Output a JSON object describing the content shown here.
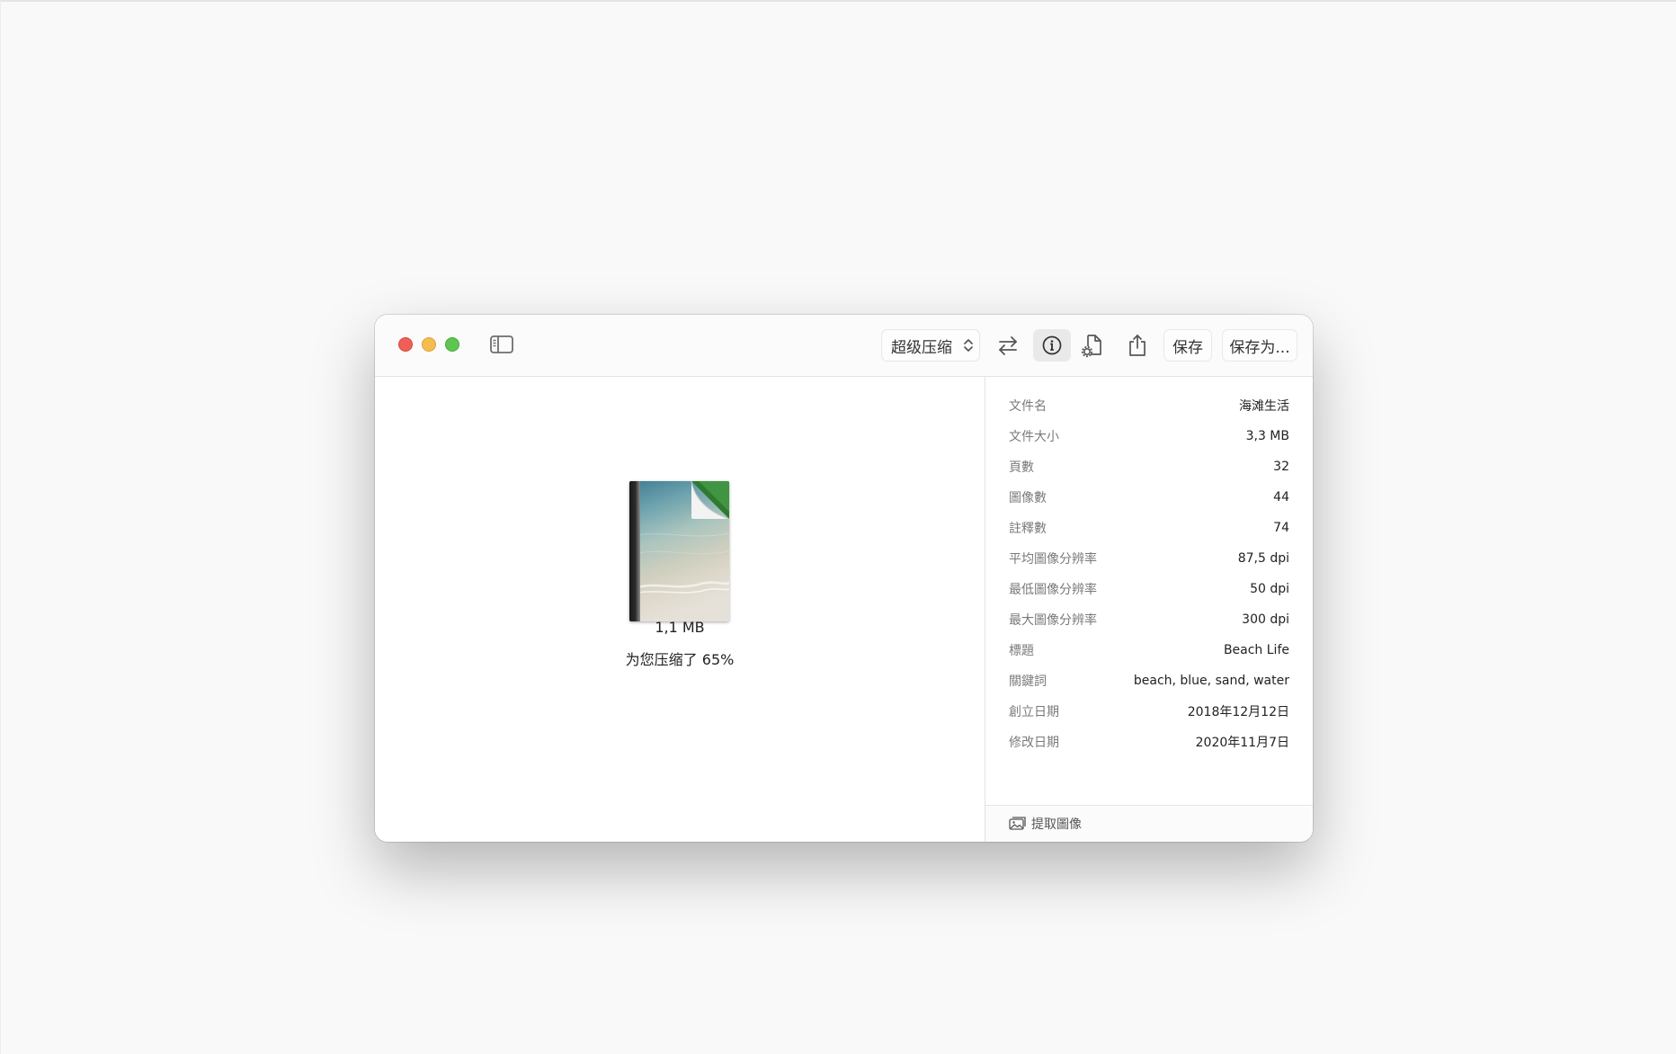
{
  "toolbar": {
    "compression_mode": "超级压缩",
    "save_label": "保存",
    "save_as_label": "保存为..."
  },
  "preview": {
    "compressed_size": "1,1 MB",
    "saved_text": "为您压缩了 65%"
  },
  "inspector": {
    "rows": [
      {
        "key": "文件名",
        "value": "海滩生活"
      },
      {
        "key": "文件大小",
        "value": "3,3 MB"
      },
      {
        "key": "頁數",
        "value": "32"
      },
      {
        "key": "圖像數",
        "value": "44"
      },
      {
        "key": "註釋數",
        "value": "74"
      },
      {
        "key": "平均圖像分辨率",
        "value": "87,5 dpi"
      },
      {
        "key": "最低圖像分辨率",
        "value": "50 dpi"
      },
      {
        "key": "最大圖像分辨率",
        "value": "300 dpi"
      },
      {
        "key": "標題",
        "value": "Beach Life"
      },
      {
        "key": "關鍵詞",
        "value": "beach, blue, sand, water"
      },
      {
        "key": "創立日期",
        "value": "2018年12月12日"
      },
      {
        "key": "修改日期",
        "value": "2020年11月7日"
      }
    ],
    "extract_label": "提取圖像"
  },
  "icons": {
    "sidebar": "sidebar-toggle-icon",
    "swap": "swap-arrows-icon",
    "info": "info-icon",
    "doc_settings": "document-settings-icon",
    "share": "share-icon",
    "extract": "extract-images-icon"
  },
  "colors": {
    "close": "#ee5f57",
    "minimize": "#f5bd4f",
    "zoom": "#5ec551"
  }
}
